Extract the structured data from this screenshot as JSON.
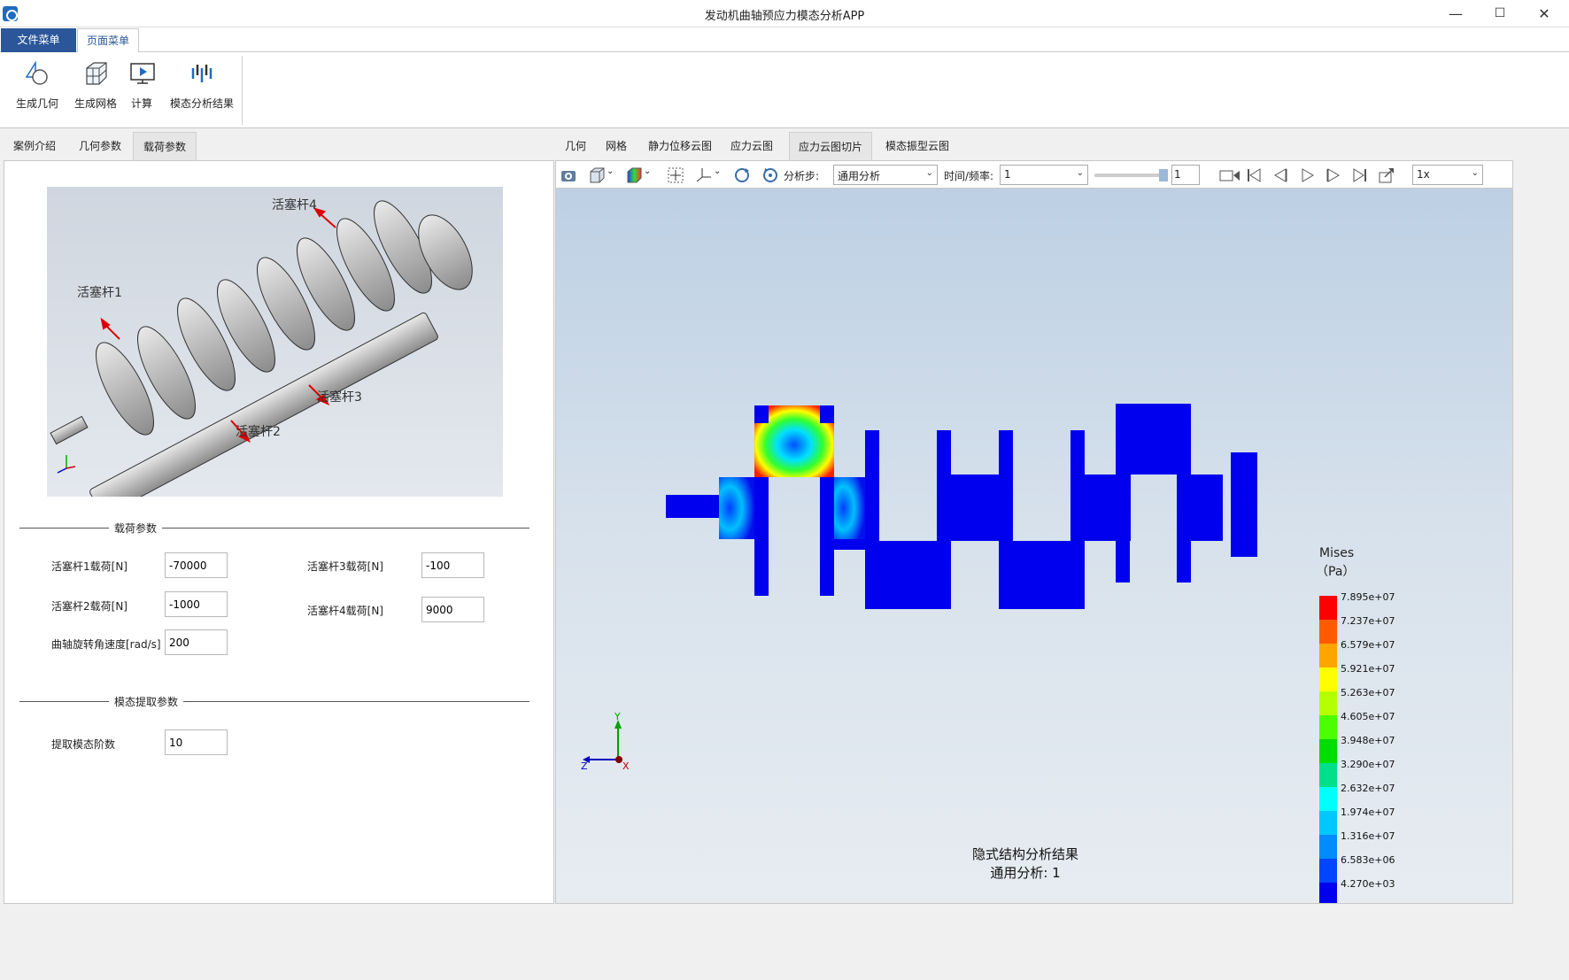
{
  "window": {
    "title": "发动机曲轴预应力模态分析APP",
    "minimize": "—",
    "maximize": "☐",
    "close": "✕"
  },
  "menu": {
    "tabs": [
      "文件菜单",
      "页面菜单"
    ]
  },
  "ribbon": {
    "buttons": [
      {
        "label": "生成几何",
        "icon": "geometry-icon"
      },
      {
        "label": "生成网格",
        "icon": "mesh-icon"
      },
      {
        "label": "计算",
        "icon": "compute-icon"
      },
      {
        "label": "模态分析结果",
        "icon": "modal-result-icon"
      }
    ]
  },
  "left_tabs": [
    "案例介绍",
    "几何参数",
    "载荷参数"
  ],
  "crank_labels": [
    "活塞杆4",
    "活塞杆1",
    "活塞杆3",
    "活塞杆2"
  ],
  "load_group": {
    "title": "载荷参数",
    "rod1_label": "活塞杆1载荷[N]",
    "rod1_value": "-70000",
    "rod2_label": "活塞杆2载荷[N]",
    "rod2_value": "-1000",
    "speed_label": "曲轴旋转角速度[rad/s]",
    "speed_value": "200",
    "rod3_label": "活塞杆3载荷[N]",
    "rod3_value": "-100",
    "rod4_label": "活塞杆4载荷[N]",
    "rod4_value": "9000"
  },
  "modal_group": {
    "title": "模态提取参数",
    "order_label": "提取模态阶数",
    "order_value": "10"
  },
  "right_tabs": [
    "几何",
    "网格",
    "静力位移云图",
    "应力云图",
    "应力云图切片",
    "模态振型云图"
  ],
  "toolbar": {
    "step_label": "分析步:",
    "step_value": "通用分析",
    "time_label": "时间/频率:",
    "time_value": "1",
    "frame_value": "1",
    "speed_value": "1x"
  },
  "viewport": {
    "caption_line1": "隐式结构分析结果",
    "caption_line2": "通用分析: 1",
    "axis_y": "Y",
    "axis_z": "Z",
    "axis_x": "X"
  },
  "legend": {
    "title": "Mises",
    "unit": "（Pa）",
    "values": [
      "7.895e+07",
      "7.237e+07",
      "6.579e+07",
      "5.921e+07",
      "5.263e+07",
      "4.605e+07",
      "3.948e+07",
      "3.290e+07",
      "2.632e+07",
      "1.974e+07",
      "1.316e+07",
      "6.583e+06",
      "4.270e+03"
    ],
    "colors": [
      "#ff0000",
      "#ff5a00",
      "#ffa500",
      "#ffff00",
      "#b4ff00",
      "#4bff00",
      "#00dd00",
      "#00e08a",
      "#00ffff",
      "#00c8ff",
      "#008cff",
      "#0046ff",
      "#0000ee"
    ]
  }
}
